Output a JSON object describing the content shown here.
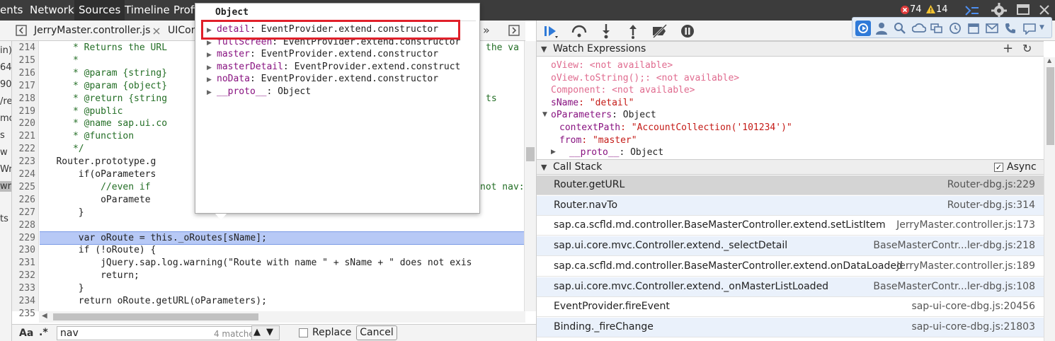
{
  "topbar": {
    "tabs": [
      "ents",
      "Network",
      "Sources",
      "Timeline",
      "Profi"
    ],
    "error_count": "74",
    "warning_count": "14"
  },
  "editor": {
    "tabs": [
      "JerryMaster.controller.js",
      "UICon"
    ],
    "overflow_label": "»",
    "left_strip_fragments": [
      "in)",
      "64",
      "90",
      "/re",
      "mo",
      "s",
      "w",
      "Wr",
      "wra",
      "ts"
    ],
    "line_numbers": [
      "214",
      "215",
      "216",
      "217",
      "218",
      "219",
      "220",
      "221",
      "222",
      "223",
      "224",
      "225",
      "226",
      "227",
      "228",
      "229",
      "230",
      "231",
      "232",
      "233",
      "234",
      "235"
    ],
    "lines": [
      {
        "indent": "      ",
        "text": "* Returns the URL",
        "tail": "the va",
        "cls": "cmt"
      },
      {
        "indent": "      ",
        "text": "*",
        "tail": "",
        "cls": "cmt"
      },
      {
        "indent": "      ",
        "text": "* @param {string}",
        "tail": "",
        "cls": "cmt"
      },
      {
        "indent": "      ",
        "text": "* @param {object}",
        "tail": "",
        "cls": "cmt"
      },
      {
        "indent": "      ",
        "text": "* @return {string",
        "tail": "ts",
        "cls": "cmt"
      },
      {
        "indent": "      ",
        "text": "* @public",
        "tail": "",
        "cls": "cmt"
      },
      {
        "indent": "      ",
        "text": "* @name sap.ui.co",
        "tail": "",
        "cls": "cmt"
      },
      {
        "indent": "      ",
        "text": "* @function",
        "tail": "",
        "cls": "cmt"
      },
      {
        "indent": "      ",
        "text": "*/",
        "tail": "",
        "cls": "cmt"
      },
      {
        "indent": "   ",
        "text": "Router.prototype.g",
        "tail": "",
        "cls": ""
      },
      {
        "indent": "       ",
        "text": "if(oParameters",
        "tail": "",
        "cls": ""
      },
      {
        "indent": "           ",
        "text": "//even if",
        "tail": "not nav:",
        "cls": "cmt"
      },
      {
        "indent": "           ",
        "text": "oParamete",
        "tail": "",
        "cls": ""
      },
      {
        "indent": "       ",
        "text": "}",
        "tail": "",
        "cls": ""
      },
      {
        "indent": "",
        "text": "",
        "tail": "",
        "cls": ""
      },
      {
        "indent": "       ",
        "text": "var oRoute = this._oRoutes[sName];",
        "tail": "",
        "cls": ""
      },
      {
        "indent": "       ",
        "text": "if (!oRoute) {",
        "tail": "",
        "cls": ""
      },
      {
        "indent": "           ",
        "text": "jQuery.sap.log.warning(\"Route with name \" + sName + \" does not exis",
        "tail": "",
        "cls": ""
      },
      {
        "indent": "           ",
        "text": "return;",
        "tail": "",
        "cls": ""
      },
      {
        "indent": "       ",
        "text": "}",
        "tail": "",
        "cls": ""
      },
      {
        "indent": "       ",
        "text": "return oRoute.getURL(oParameters);",
        "tail": "",
        "cls": ""
      },
      {
        "indent": "",
        "text": "",
        "tail": "",
        "cls": ""
      }
    ]
  },
  "popup": {
    "title": "Object",
    "items": [
      {
        "key": "detail",
        "value": ": EventProvider.extend.constructor"
      },
      {
        "key": "fullScreen",
        "value": ": EventProvider.extend.constructor"
      },
      {
        "key": "master",
        "value": ": EventProvider.extend.constructor"
      },
      {
        "key": "masterDetail",
        "value": ": EventProvider.extend.construct"
      },
      {
        "key": "noData",
        "value": ": EventProvider.extend.constructor"
      },
      {
        "key": "__proto__",
        "value": ": Object"
      }
    ]
  },
  "search": {
    "aa_label": "Aa",
    "regex_label": ".*",
    "value": "nav",
    "matches": "4 matches",
    "replace_label": "Replace",
    "cancel_label": "Cancel"
  },
  "watch": {
    "header": "Watch Expressions",
    "lines": [
      {
        "name": "oView",
        "value": ": <not available>",
        "na": true
      },
      {
        "name": "oView.toString();",
        "value": ": <not available>",
        "na": true
      },
      {
        "name": "Component",
        "value": ": <not available>",
        "na": true
      },
      {
        "name": "sName",
        "value": ": \"detail\"",
        "na": false
      },
      {
        "name": "oParameters",
        "value": ": Object",
        "na": false
      },
      {
        "name": "contextPath",
        "value": ": \"AccountCollection('101234')\"",
        "na": false
      },
      {
        "name": "from",
        "value": ": \"master\"",
        "na": false
      },
      {
        "name": "__proto__",
        "value": ": Object",
        "na": false
      }
    ]
  },
  "callstack": {
    "header": "Call Stack",
    "async_label": "Async",
    "frames": [
      {
        "fn": "Router.getURL",
        "loc": "Router-dbg.js:229"
      },
      {
        "fn": "Router.navTo",
        "loc": "Router-dbg.js:314"
      },
      {
        "fn": "sap.ca.scfld.md.controller.BaseMasterController.extend.setListItem",
        "loc": "JerryMaster.controller.js:173"
      },
      {
        "fn": "sap.ui.core.mvc.Controller.extend._selectDetail",
        "loc": "BaseMasterContr...ler-dbg.js:218"
      },
      {
        "fn": "sap.ca.scfld.md.controller.BaseMasterController.extend.onDataLoaded",
        "loc": "JerryMaster.controller.js:189"
      },
      {
        "fn": "sap.ui.core.mvc.Controller.extend._onMasterListLoaded",
        "loc": "BaseMasterContr...ler-dbg.js:108"
      },
      {
        "fn": "EventProvider.fireEvent",
        "loc": "sap-ui-core-dbg.js:20456"
      },
      {
        "fn": "Binding._fireChange",
        "loc": "sap-ui-core-dbg.js:21803"
      }
    ]
  },
  "colors": {
    "selected_row": "#d4d4d4",
    "alt_row": "#eaf1fb",
    "highlight_line": "#b7c9f6",
    "popup_border": "#e0202a"
  }
}
